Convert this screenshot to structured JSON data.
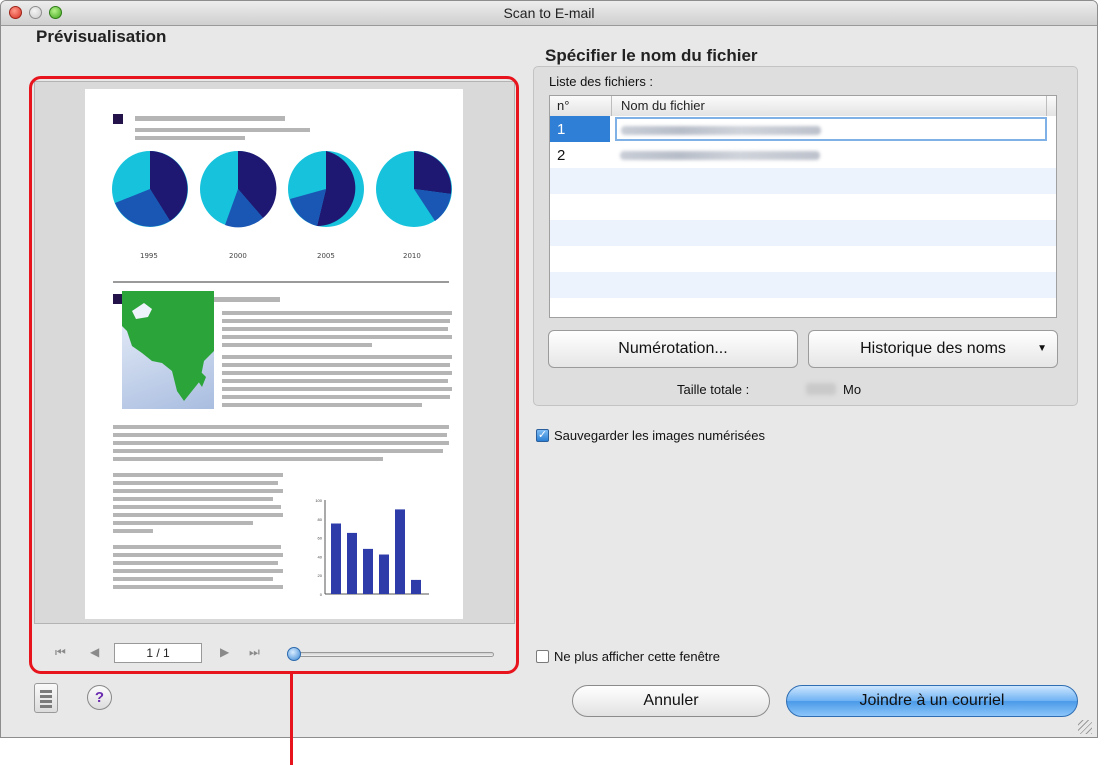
{
  "window": {
    "title": "Scan to E-mail"
  },
  "preview": {
    "title": "Prévisualisation",
    "page_indicator": "1 / 1",
    "zoom_level": 0.0,
    "document": {
      "pie_years": [
        "1995",
        "2000",
        "2005",
        "2010"
      ],
      "pie_colors": {
        "primary": "#1f1873",
        "secondary": "#1a56b3",
        "tertiary": "#16c2dc"
      },
      "bar_axis_ticks": [
        "100",
        "80",
        "60",
        "40",
        "20",
        "0"
      ],
      "bar_values": [
        75,
        65,
        48,
        42,
        90,
        15
      ]
    }
  },
  "filename_panel": {
    "title": "Spécifier le nom du fichier",
    "list_label": "Liste des fichiers :",
    "columns": [
      "n°",
      "Nom du fichier"
    ],
    "rows": [
      {
        "num": "1",
        "name_redacted": true,
        "selected": true
      },
      {
        "num": "2",
        "name_redacted": true,
        "selected": false
      }
    ],
    "numbering_button": "Numérotation...",
    "history_button": "Historique des noms",
    "total_size_label": "Taille totale :",
    "total_size_unit": "Mo"
  },
  "save_images": {
    "label": "Sauvegarder les images numérisées",
    "checked": true
  },
  "dont_show": {
    "label": "Ne plus afficher cette fenêtre",
    "checked": false
  },
  "buttons": {
    "cancel": "Annuler",
    "attach": "Joindre à un courriel",
    "help": "?"
  },
  "colors": {
    "highlight": "#e8141d",
    "selection": "#2f7fd6",
    "accent_button": "#4a9ae8"
  }
}
